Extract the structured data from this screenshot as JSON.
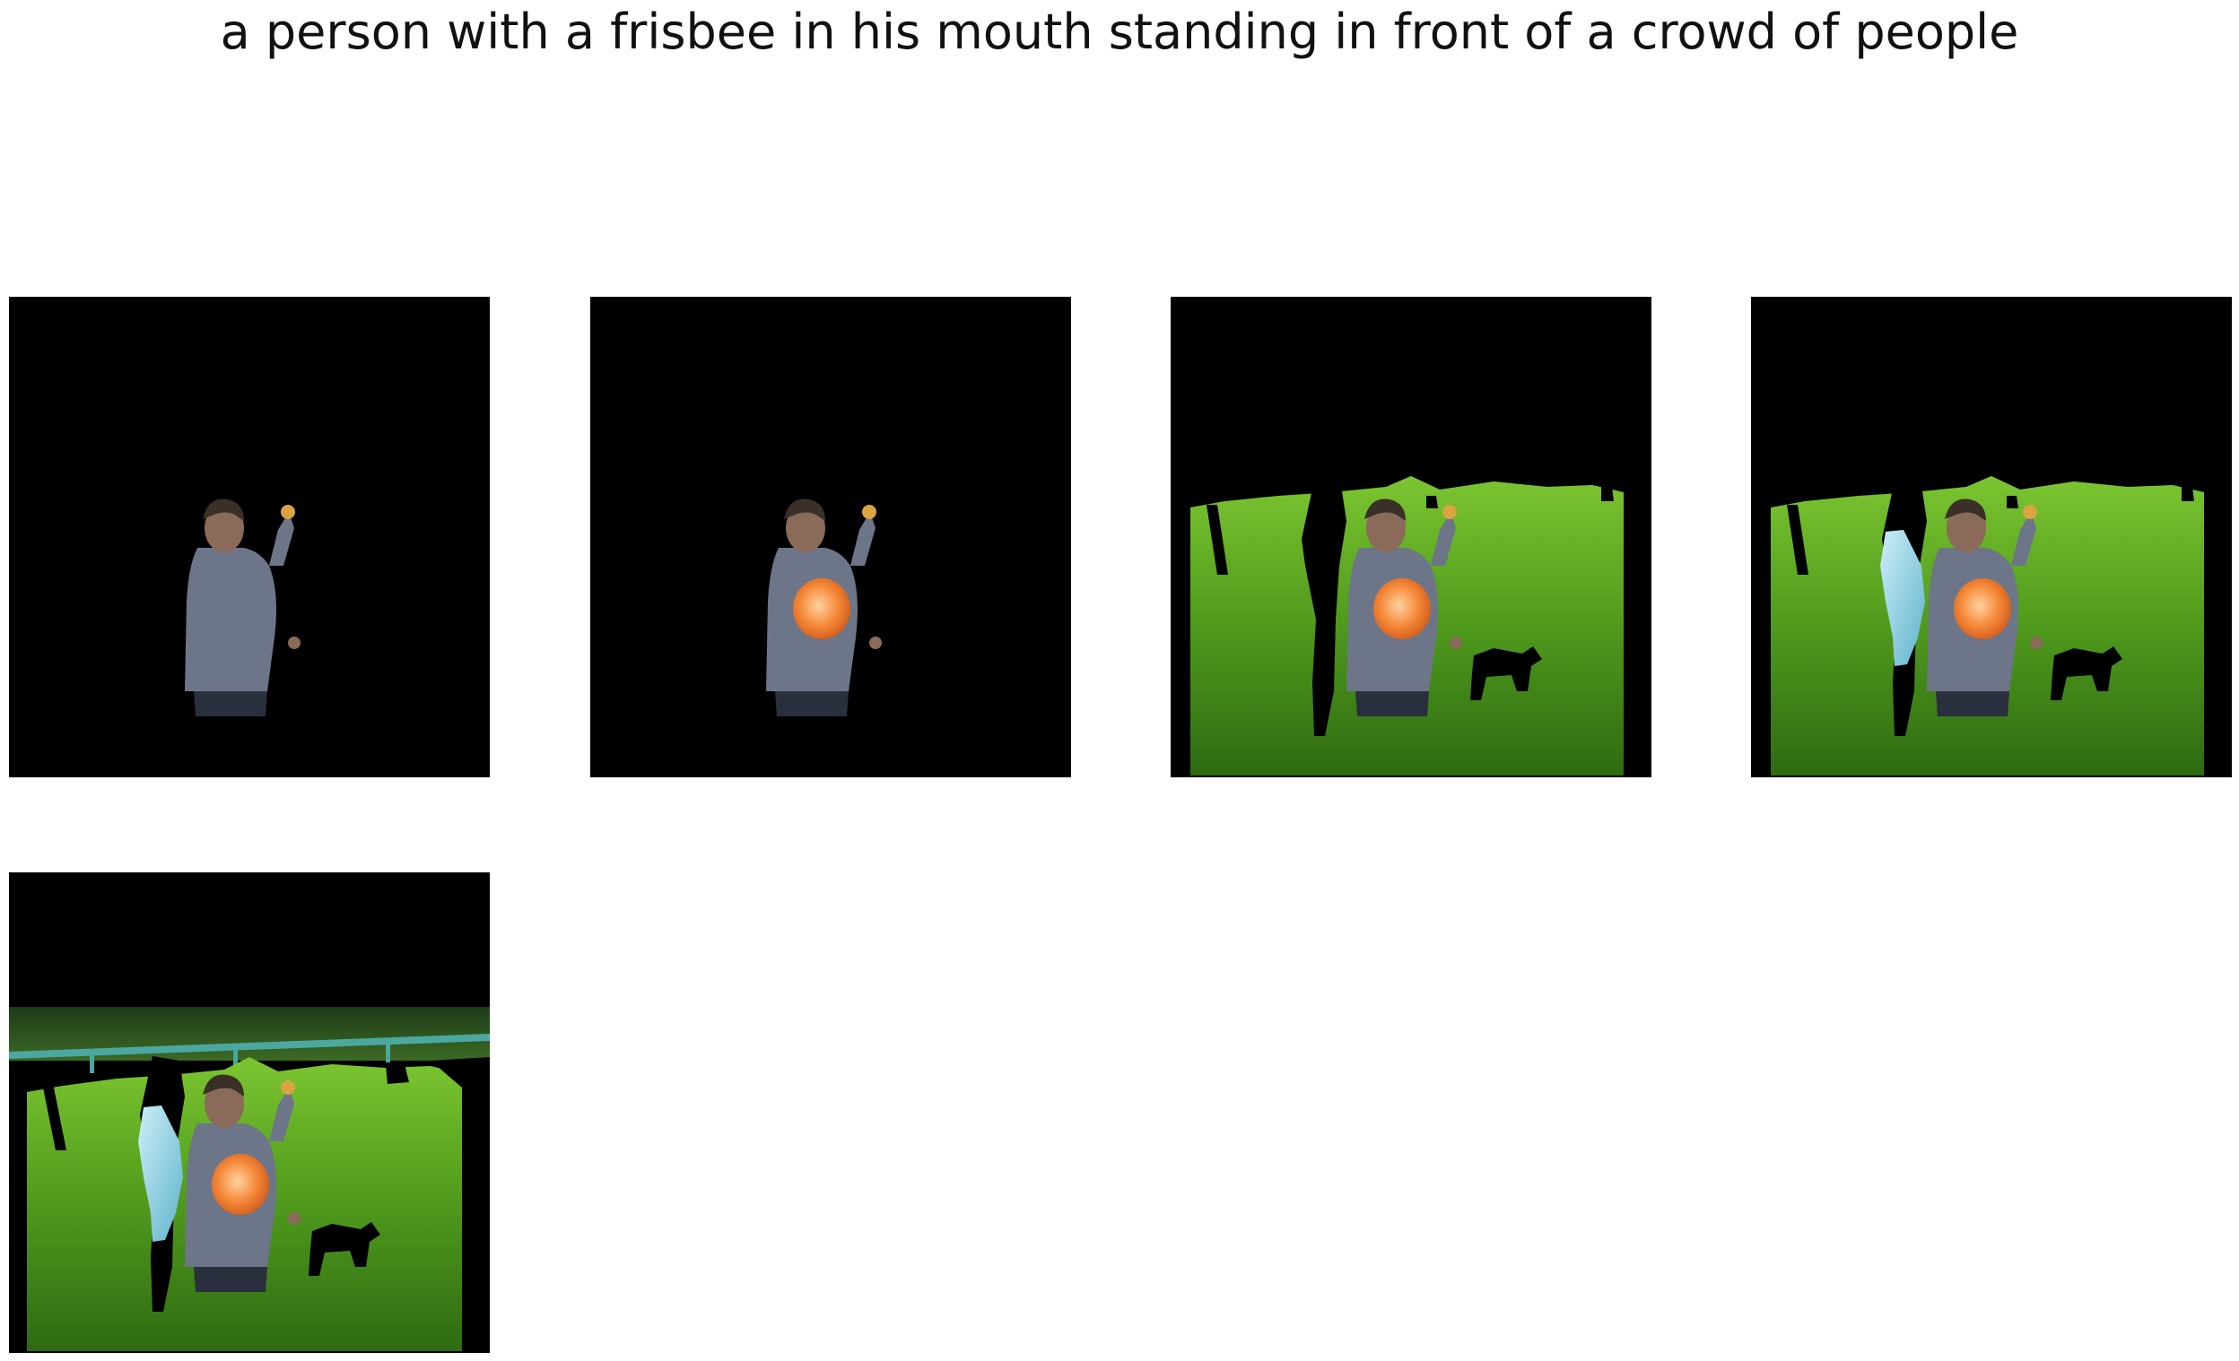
{
  "caption": "a person with a frisbee in his mouth standing in front of a crowd of people",
  "panels": [
    {
      "reveals": [
        "person"
      ]
    },
    {
      "reveals": [
        "person",
        "frisbee"
      ]
    },
    {
      "reveals": [
        "person",
        "frisbee",
        "grass-lawn",
        "tree-trunk",
        "dog-silhouette"
      ]
    },
    {
      "reveals": [
        "person",
        "frisbee",
        "grass-lawn",
        "tree-trunk",
        "dog-silhouette",
        "second-person-blue"
      ]
    },
    {
      "reveals": [
        "person",
        "frisbee",
        "grass-lawn",
        "tree-trunk",
        "dog-silhouette",
        "second-person-blue",
        "fence-and-trees"
      ]
    }
  ],
  "colors": {
    "background": "#000000",
    "grass": "#4f9a1c",
    "frisbee": "#f58a3a",
    "shirt": "#6d7588",
    "fence": "#4aa8a0",
    "second_person": "#8fd3e6"
  }
}
